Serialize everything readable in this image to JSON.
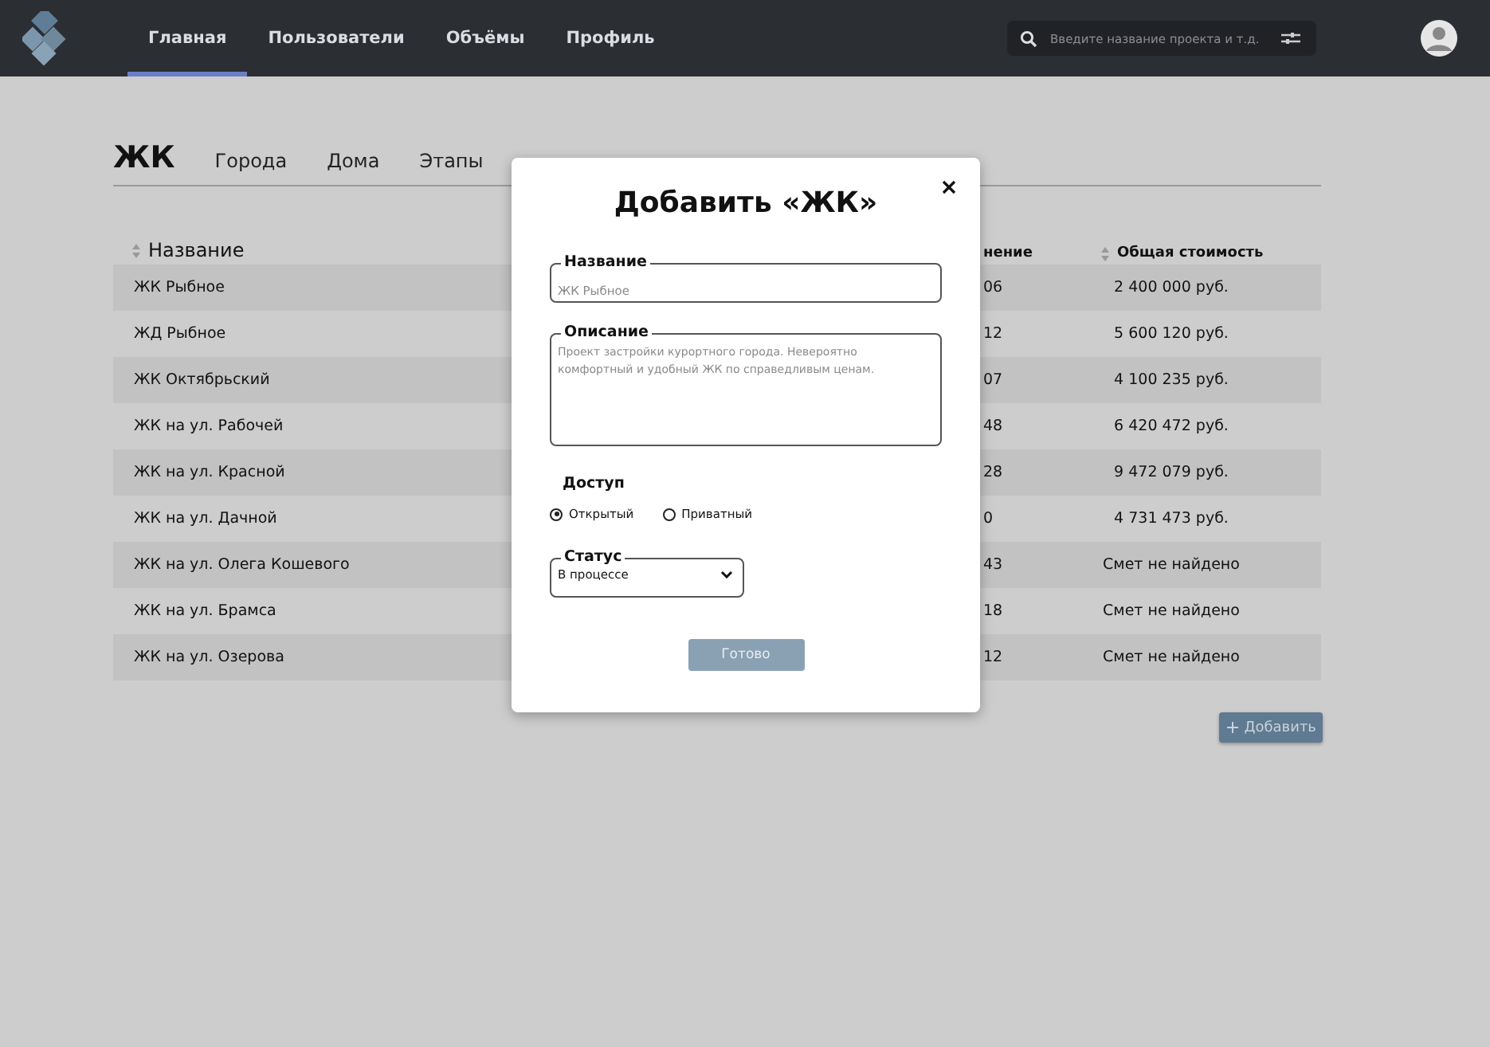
{
  "nav": {
    "items": [
      {
        "label": "Главная",
        "selected": true
      },
      {
        "label": "Пользователи",
        "selected": false
      },
      {
        "label": "Объёмы",
        "selected": false
      },
      {
        "label": "Профиль",
        "selected": false
      }
    ],
    "search": {
      "placeholder": "Введите название проекта и т.д."
    }
  },
  "tabs": [
    {
      "label": "ЖК",
      "selected": true
    },
    {
      "label": "Города",
      "selected": false
    },
    {
      "label": "Дома",
      "selected": false
    },
    {
      "label": "Этапы",
      "selected": false
    }
  ],
  "table": {
    "columns": [
      "Название",
      "нение",
      "Общая стоимость"
    ],
    "rows": [
      [
        "ЖК Рыбное",
        "06",
        "2 400 000 руб."
      ],
      [
        "ЖД Рыбное",
        "12",
        "5 600 120 руб."
      ],
      [
        "ЖК Октябрьский",
        "07",
        "4 100 235 руб."
      ],
      [
        "ЖК на ул. Рабочей",
        "48",
        "6 420 472 руб."
      ],
      [
        "ЖК на ул. Красной",
        "28",
        "9 472 079 руб."
      ],
      [
        "ЖК на ул. Дачной",
        "0",
        "4 731 473 руб."
      ],
      [
        "ЖК на ул. Олега Кошевого",
        "43",
        "Смет не найдено"
      ],
      [
        "ЖК на ул. Брамса",
        "18",
        "Смет не найдено"
      ],
      [
        "ЖК на ул. Озерова",
        "12",
        "Смет не найдено"
      ]
    ]
  },
  "add_button": "Добавить",
  "dialog": {
    "title": "Добавить «ЖК»",
    "name_field": {
      "label": "Название",
      "placeholder": "ЖК Рыбное"
    },
    "description_field": {
      "label": "Описание",
      "placeholder": "Проект застройки курортного города. Невероятно комфортный и удобный ЖК по справедливым ценам."
    },
    "access": {
      "label": "Доступ",
      "options": [
        {
          "label": "Открытый",
          "selected": true
        },
        {
          "label": "Приватный",
          "selected": false
        }
      ]
    },
    "status": {
      "label": "Статус",
      "value": "В процессе"
    },
    "submit": {
      "label": "Готово",
      "disabled": true
    }
  }
}
